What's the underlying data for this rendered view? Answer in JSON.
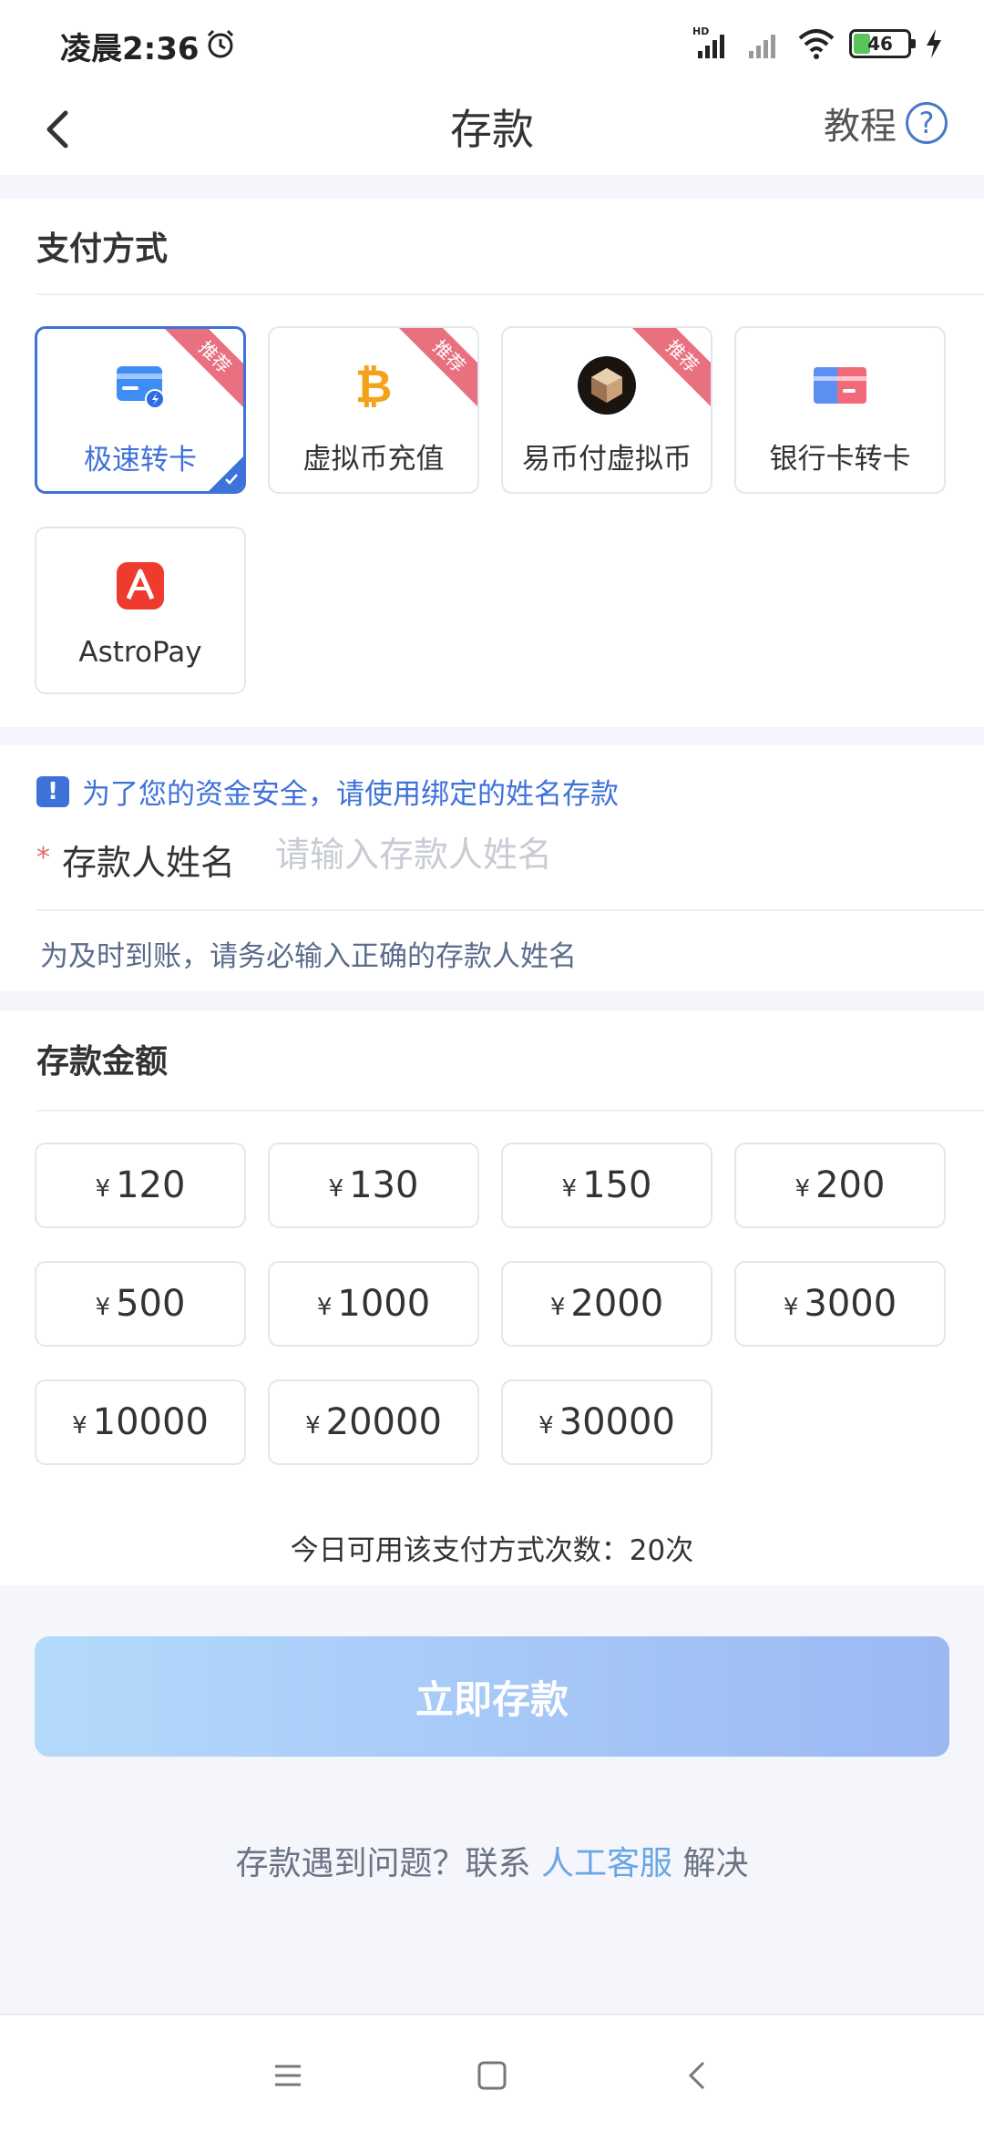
{
  "status_bar": {
    "time": "凌晨2:36",
    "battery": "46",
    "network": "HD"
  },
  "nav": {
    "title": "存款",
    "tutorial": "教程",
    "help_glyph": "?"
  },
  "payment": {
    "title": "支付方式",
    "methods": [
      {
        "label": "极速转卡",
        "badge": "推荐",
        "selected": true,
        "icon": "card-icon"
      },
      {
        "label": "虚拟币充值",
        "badge": "推荐",
        "selected": false,
        "icon": "bitcoin-icon"
      },
      {
        "label": "易币付虚拟币",
        "badge": "推荐",
        "selected": false,
        "icon": "ebpay-icon"
      },
      {
        "label": "银行卡转卡",
        "badge": "",
        "selected": false,
        "icon": "bank-card-icon"
      },
      {
        "label": "AstroPay",
        "badge": "",
        "selected": false,
        "icon": "astropay-icon"
      }
    ]
  },
  "name_form": {
    "notice": "为了您的资金安全，请使用绑定的姓名存款",
    "notice_glyph": "!",
    "required_mark": "*",
    "label": "存款人姓名",
    "placeholder": "请输入存款人姓名",
    "value": "",
    "hint": "为及时到账，请务必输入正确的存款人姓名"
  },
  "amount": {
    "title": "存款金额",
    "currency": "¥",
    "options": [
      "120",
      "130",
      "150",
      "200",
      "500",
      "1000",
      "2000",
      "3000",
      "10000",
      "20000",
      "30000"
    ],
    "daily_limit": "今日可用该支付方式次数：20次"
  },
  "submit_label": "立即存款",
  "help": {
    "prefix": "存款遇到问题？联系 ",
    "link": "人工客服",
    "suffix": " 解决"
  },
  "colors": {
    "accent": "#3f72d9",
    "badge": "#e8707f",
    "link": "#6aa6e6",
    "button_start": "#b3dafb",
    "button_end": "#9bb8f3"
  }
}
